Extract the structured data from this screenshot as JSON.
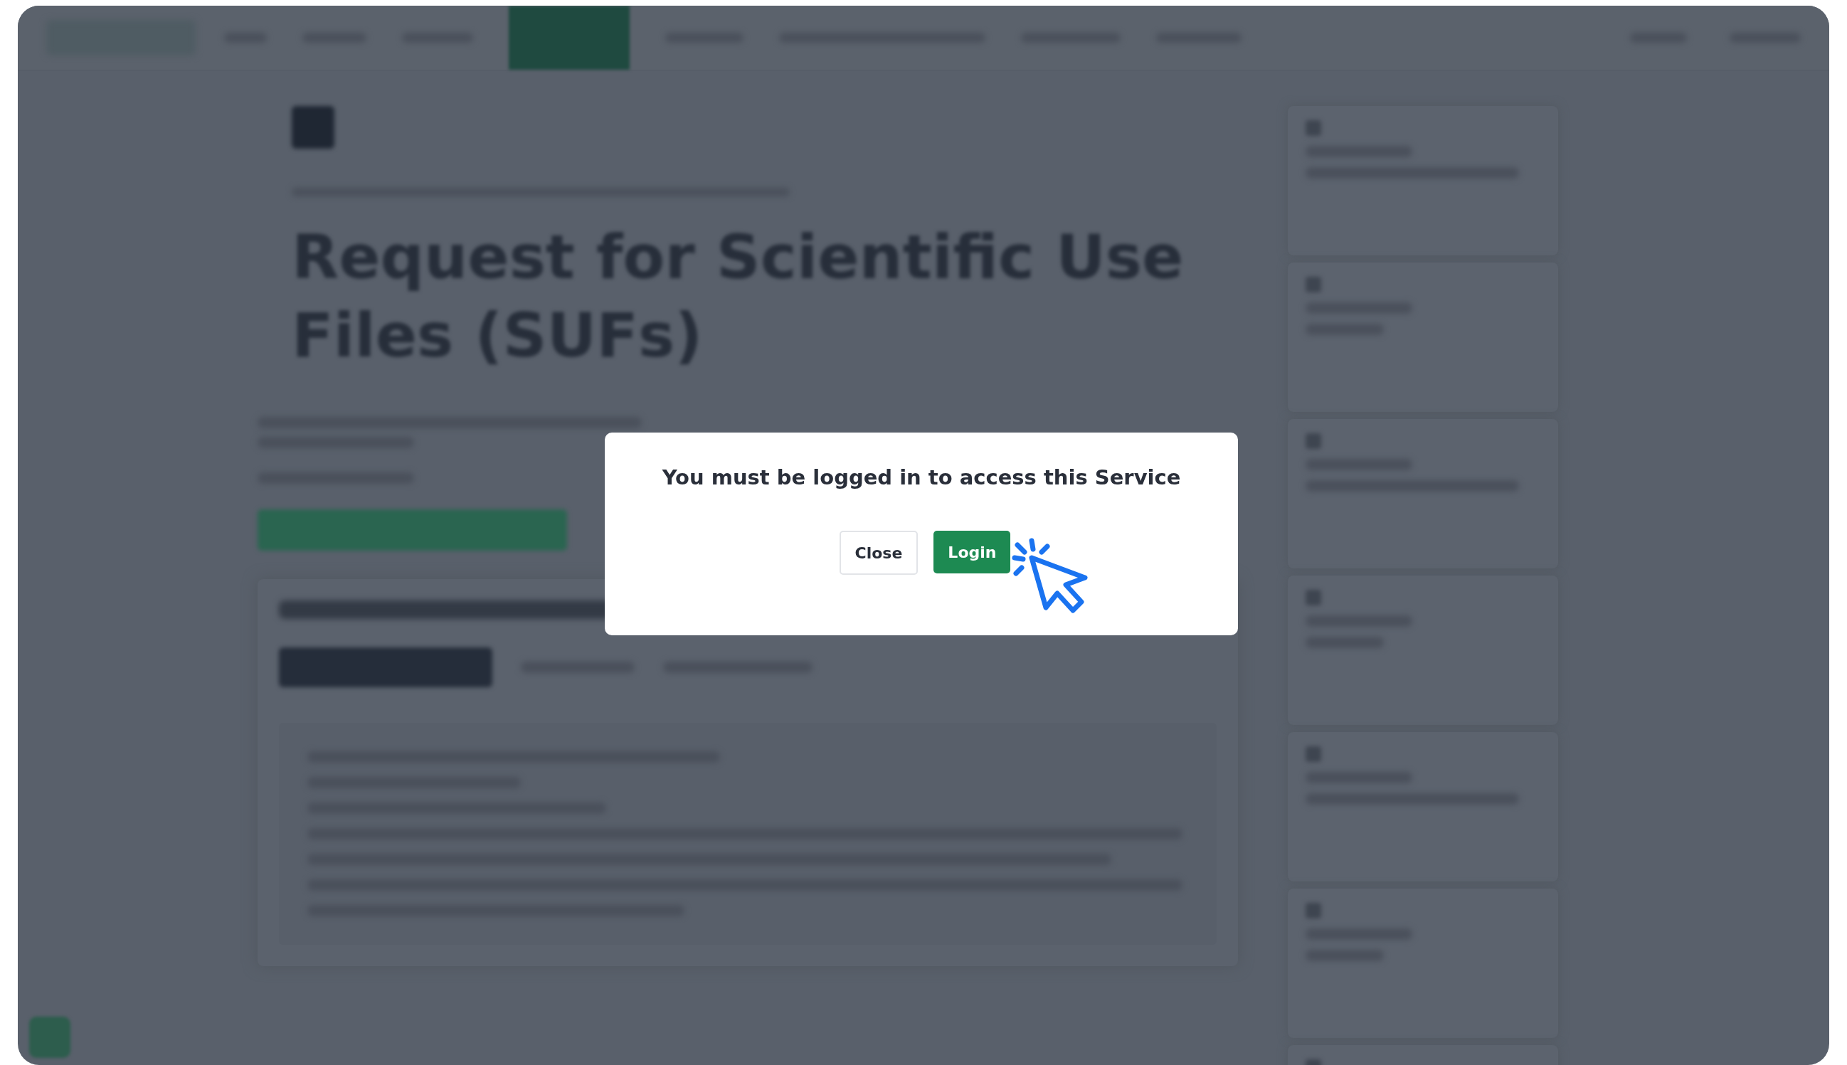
{
  "page": {
    "title": "Request for Scientific Use Files (SUFs)"
  },
  "dialog": {
    "message": "You must be logged in to access this Service",
    "buttons": [
      {
        "label": "Close",
        "kind": "secondary"
      },
      {
        "label": "Login",
        "kind": "primary"
      }
    ]
  }
}
